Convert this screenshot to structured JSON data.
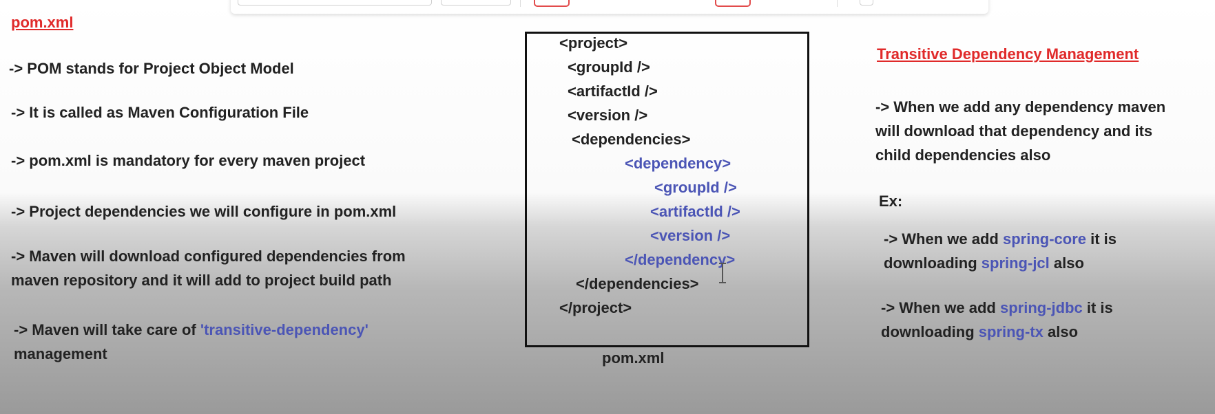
{
  "left": {
    "title": "pom.xml",
    "points": [
      "-> POM stands for Project Object Model",
      "-> It is called as Maven Configuration File",
      "-> pom.xml is mandatory for every maven project",
      "-> Project dependencies we will configure in pom.xml",
      "-> Maven will download configured dependencies from",
      "maven repository and it will add to project build path"
    ],
    "last_point": {
      "prefix": "-> Maven will take care of ",
      "highlight": "'transitive-dependency'",
      "suffix": "management"
    }
  },
  "xml": {
    "lines": [
      "<project>",
      "<groupId />",
      "<artifactId />",
      "<version />",
      "<dependencies>",
      "<dependency>",
      "<groupId />",
      "<artifactId />",
      "<version />",
      "</dependency>",
      "</dependencies>",
      "</project>"
    ],
    "caption": "pom.xml"
  },
  "right": {
    "title": "Transitive Dependency Management",
    "intro": [
      "-> When we add any dependency maven",
      "will download that dependency and its",
      "child dependencies also"
    ],
    "ex_label": "Ex:",
    "example1": {
      "prefix": "-> When we add ",
      "dep": "spring-core",
      "mid": " it is",
      "line2_prefix": "downloading ",
      "child": "spring-jcl",
      "suffix": " also"
    },
    "example2": {
      "prefix": "-> When we add ",
      "dep": "spring-jdbc",
      "mid": " it is",
      "line2_prefix": "downloading ",
      "child": "spring-tx",
      "suffix": " also"
    }
  },
  "colors": {
    "heading": "#e02a2a",
    "highlight": "#4b55b5"
  }
}
